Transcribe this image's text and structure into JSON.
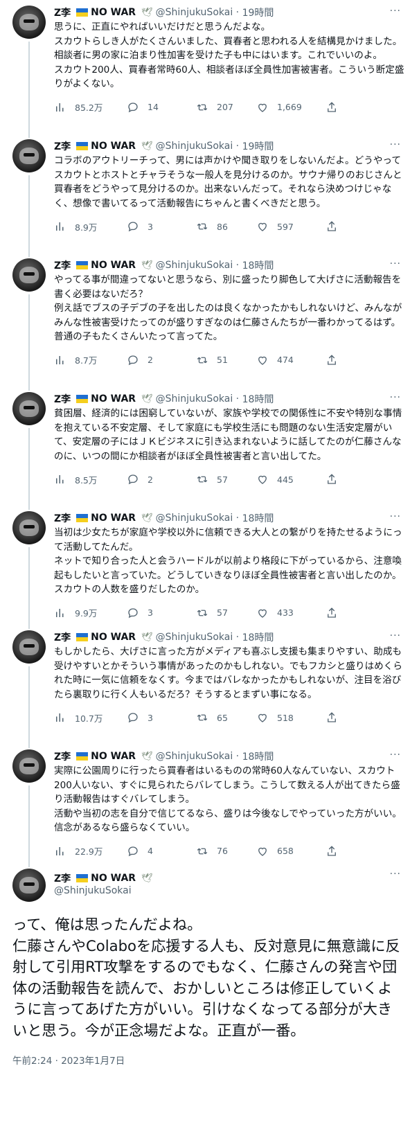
{
  "author": {
    "name": "Z李",
    "suffix": "NO WAR",
    "handle": "@ShinjukuSokai",
    "flag_colors": {
      "top": "#1f6fd1",
      "bottom": "#f5cf1e"
    },
    "dove_icon": "dove-icon"
  },
  "more_label": "···",
  "tweets": [
    {
      "time": "19時間",
      "text": "思うに、正直にやればいいだけだと思うんだよな。\nスカウトらしき人がたくさんいました、買春者と思われる人を結構見かけました。相談者に男の家に泊まり性加害を受けた子も中にはいます。これでいいのよ。\nスカウト200人、買春者常時60人、相談者ほぼ全員性加害被害者。こういう断定盛りがよくない。",
      "views": "85.2万",
      "replies": "14",
      "retweets": "207",
      "likes": "1,669"
    },
    {
      "time": "19時間",
      "text": "コラボのアウトリーチって、男には声かけや聞き取りをしないんだよ。どうやってスカウトとホストとチャラそうな一般人を見分けるのか。サウナ帰りのおじさんと買春者をどうやって見分けるのか。出来ないんだって。それなら決めつけじゃなく、想像で書いてるって活動報告にちゃんと書くべきだと思う。",
      "views": "8.9万",
      "replies": "3",
      "retweets": "86",
      "likes": "597"
    },
    {
      "time": "18時間",
      "text": "やってる事が間違ってないと思うなら、別に盛ったり脚色して大げさに活動報告を書く必要はないだろ？\n例え話でブスの子デブの子を出したのは良くなかったかもしれないけど、みんながみんな性被害受けたってのが盛りすぎなのは仁藤さんたちが一番わかってるはず。\n普通の子もたくさんいたって言ってた。",
      "views": "8.7万",
      "replies": "2",
      "retweets": "51",
      "likes": "474"
    },
    {
      "time": "18時間",
      "text": "貧困層、経済的には困窮していないが、家族や学校での関係性に不安や特別な事情を抱えている不安定層、そして家庭にも学校生活にも問題のない生活安定層がいて、安定層の子にはＪＫビジネスに引き込まれないように話してたのが仁藤さんなのに、いつの間にか相談者がほぼ全員性被害者と言い出してた。",
      "views": "8.5万",
      "replies": "2",
      "retweets": "57",
      "likes": "445"
    },
    {
      "time": "18時間",
      "text": "当初は少女たちが家庭や学校以外に信頼できる大人との繋がりを持たせるようにって活動してたんだ。\nネットで知り合った人と会うハードルが以前より格段に下がっているから、注意喚起もしたいと言っていた。どうしていきなりほぼ全員性被害者と言い出したのか。スカウトの人数を盛りだしたのか。",
      "views": "9.9万",
      "replies": "3",
      "retweets": "57",
      "likes": "433"
    },
    {
      "time": "18時間",
      "text": "もしかしたら、大げさに言った方がメディアも喜ぶし支援も集まりやすい、助成も受けやすいとかそういう事情があったのかもしれない。でもフカシと盛りはめくられた時に一気に信頼をなくす。今まではバレなかったかもしれないが、注目を浴びたら裏取りに行く人もいるだろ？そうするとまずい事になる。",
      "views": "10.7万",
      "replies": "3",
      "retweets": "65",
      "likes": "518"
    },
    {
      "time": "18時間",
      "text": "実際に公園周りに行ったら買春者はいるものの常時60人なんていない、スカウト200人いない、すぐに見られたらバレてしまう。こうして数える人が出てきたら盛り活動報告はすぐバレてしまう。\n活動や当初の志を自分で信じてるなら、盛りは今後なしでやっていった方がいい。信念があるなら盛らなくていい。",
      "views": "22.9万",
      "replies": "4",
      "retweets": "76",
      "likes": "658"
    }
  ],
  "main_tweet": {
    "text": "って、俺は思ったんだよね。\n仁藤さんやColaboを応援する人も、反対意見に無意識に反射して引用RT攻撃をするのでもなく、仁藤さんの発言や団体の活動報告を読んで、おかしいところは修正していくように言ってあげた方がいい。引けなくなってる部分が大きいと思う。今が正念場だよな。正直が一番。",
    "timestamp": "午前2:24 · 2023年1月7日"
  }
}
